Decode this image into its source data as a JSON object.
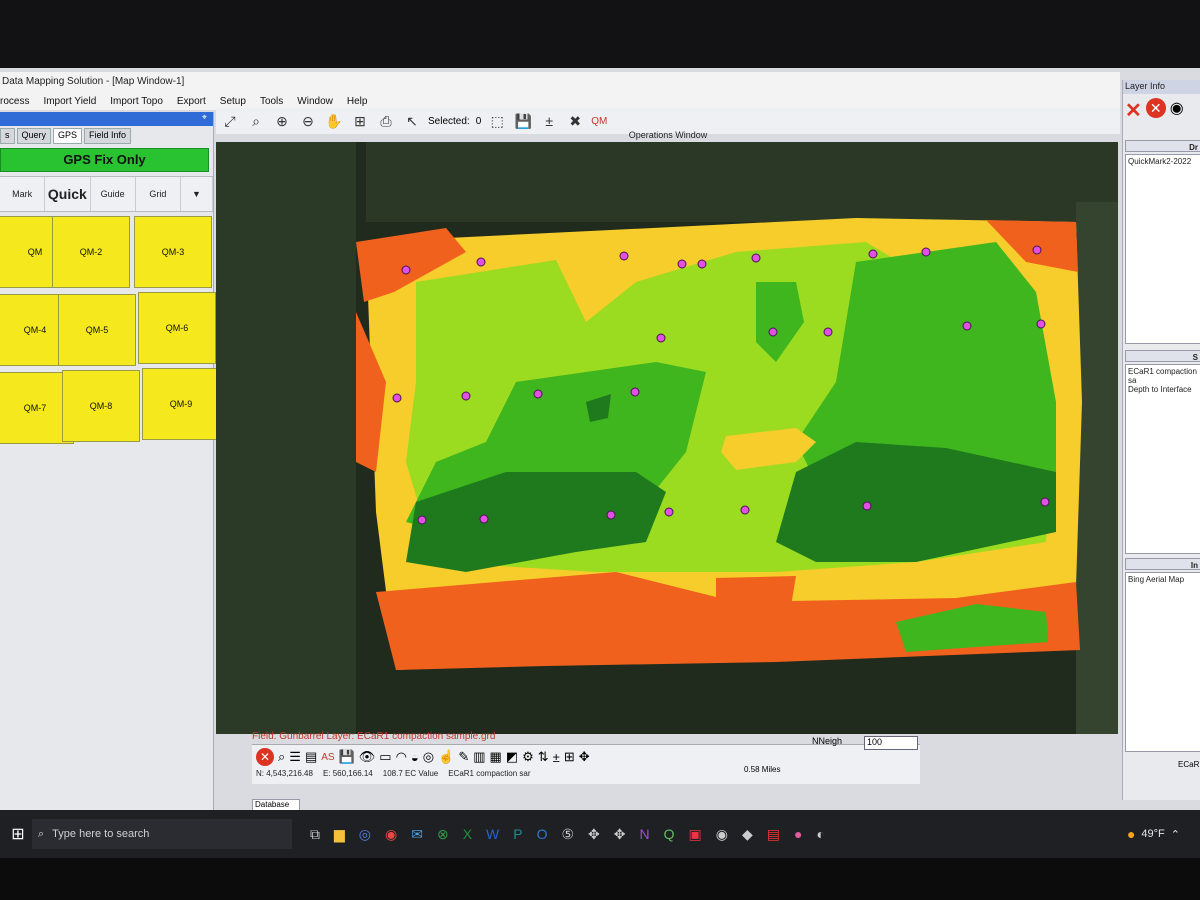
{
  "window": {
    "title": "Data Mapping Solution - [Map Window-1]",
    "menu": [
      "rocess",
      "Import Yield",
      "Import Topo",
      "Export",
      "Setup",
      "Tools",
      "Window",
      "Help"
    ]
  },
  "left_panel": {
    "tabs": [
      "s",
      "Query",
      "GPS",
      "Field Info"
    ],
    "gps_status": "GPS Fix Only",
    "modes": [
      "Mark",
      "Quick",
      "Guide",
      "Grid"
    ],
    "quickmarks": [
      "QM",
      "QM-2",
      "QM-3",
      "QM-4",
      "QM-5",
      "QM-6",
      "QM-7",
      "QM-8",
      "QM-9"
    ]
  },
  "toolbar": {
    "selected_label": "Selected:",
    "selected_count": "0",
    "qm_label": "QM",
    "operations_window": "Operations Window"
  },
  "map": {
    "field_line": "Field: Gunbarrel  Layer: ECaR1 compaction sample.grd",
    "colors": {
      "orange": "#f0611d",
      "yellow": "#f6cd2a",
      "lime": "#9bdb20",
      "green": "#3fb51e",
      "darkgreen": "#1e7a1c",
      "point": "#e24fe3"
    }
  },
  "right_panel": {
    "title": "Layer Info",
    "col_heading": "Dr",
    "layers": [
      "QuickMark2-2022"
    ],
    "sel_heading": "S",
    "selected_layers": [
      "ECaR1 compaction sa",
      "Depth to Interface"
    ],
    "img_heading": "In",
    "images": [
      "Bing Aerial Map"
    ]
  },
  "status_bar": {
    "northing": "N: 4,543,216.48",
    "easting": "E: 560,166.14",
    "ec_value": "108.7 EC Value",
    "layer_short": "ECaR1 compaction sar",
    "nneigh": "NNeigh",
    "zoom_value": "100",
    "scale": "0.58 Miles",
    "database_tab": "Database",
    "right_text": "ECaR"
  },
  "taskbar": {
    "search_placeholder": "Type here to search",
    "temperature": "49°F"
  }
}
